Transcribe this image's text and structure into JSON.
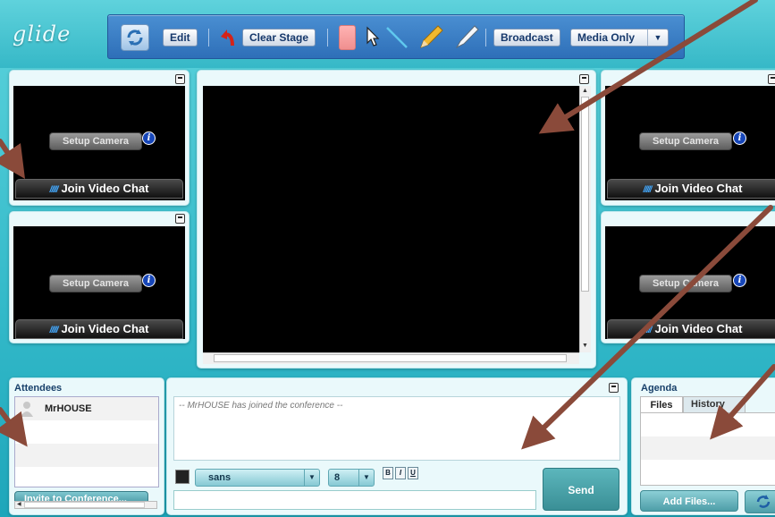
{
  "app": {
    "logo": "glide"
  },
  "toolbar": {
    "edit_label": "Edit",
    "clear_stage_label": "Clear Stage",
    "broadcast_label": "Broadcast",
    "media_mode_value": "Media Only",
    "icons": [
      "refresh-icon",
      "undo-icon",
      "eraser-icon",
      "pointer-icon",
      "line-icon",
      "pencil-icon",
      "pen-icon"
    ]
  },
  "video": {
    "setup_camera_label": "Setup Camera",
    "join_video_chat_label": "Join Video Chat",
    "info_glyph": "i"
  },
  "attendees": {
    "title": "Attendees",
    "list": [
      {
        "name": "MrHOUSE"
      }
    ],
    "invite_label": "Invite to Conference..."
  },
  "chat": {
    "log": [
      "-- MrHOUSE has joined the conference --"
    ],
    "font_family_value": "sans",
    "font_size_value": "8",
    "bold_label": "B",
    "italic_label": "I",
    "underline_label": "U",
    "message_value": "",
    "send_label": "Send"
  },
  "agenda": {
    "title": "Agenda",
    "tabs": [
      {
        "label": "Files",
        "active": true
      },
      {
        "label": "History",
        "active": false
      }
    ],
    "add_files_label": "Add Files..."
  },
  "colors": {
    "background": "#33b9c9",
    "toolbar": "#3a7fc6",
    "video_screen": "#000000",
    "send_button": "#4fa7ad",
    "annotation_arrow": "#8a4a3a"
  }
}
